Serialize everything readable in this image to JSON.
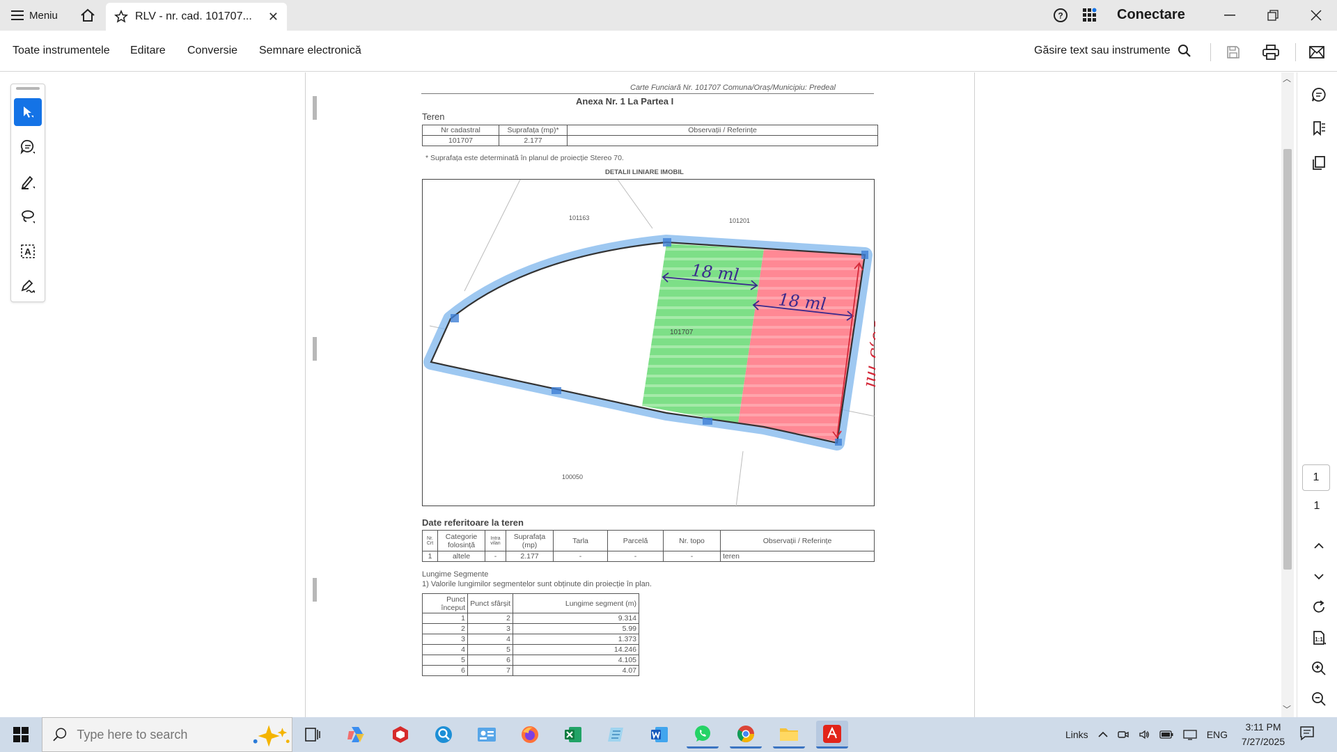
{
  "titlebar": {
    "menu_label": "Meniu",
    "tab_title": "RLV - nr. cad. 101707...",
    "signin_label": "Conectare"
  },
  "toolbar": {
    "items": [
      "Toate instrumentele",
      "Editare",
      "Conversie",
      "Semnare electronică"
    ],
    "find_label": "Găsire text sau instrumente"
  },
  "document": {
    "header_ref": "Carte Funciară Nr. 101707 Comuna/Oraș/Municipiu: Predeal",
    "title": "Anexa Nr. 1 La Partea I",
    "teren_label": "Teren",
    "teren_table": {
      "headers": [
        "Nr cadastral",
        "Suprafața (mp)*",
        "Observații / Referințe"
      ],
      "row": [
        "101707",
        "2.177",
        ""
      ]
    },
    "footnote": "* Suprafața este determinată în planul de proiecție Stereo 70.",
    "plan_title": "DETALII LINIARE IMOBIL",
    "plan_labels": {
      "parcel_nw": "101163",
      "parcel_ne": "101201",
      "parcel_main": "101707",
      "parcel_s": "100050",
      "width_a": "18 ml",
      "width_b": "18 ml",
      "length": "36,5 ml"
    },
    "date_title": "Date referitoare la teren",
    "date_table": {
      "headers": [
        "Nr. Crt",
        "Categorie folosință",
        "Intra vilan",
        "Suprafața (mp)",
        "Tarla",
        "Parcelă",
        "Nr. topo",
        "Observații / Referințe"
      ],
      "row": [
        "1",
        "altele",
        "-",
        "2.177",
        "-",
        "-",
        "-",
        "teren"
      ]
    },
    "segment_title": "Lungime Segmente",
    "segment_note": "1) Valorile lungimilor segmentelor sunt obținute din proiecție în plan.",
    "segment_table": {
      "headers": [
        "Punct început",
        "Punct sfârșit",
        "Lungime segment (m)"
      ],
      "rows": [
        [
          "1",
          "2",
          "9.314"
        ],
        [
          "2",
          "3",
          "5.99"
        ],
        [
          "3",
          "4",
          "1.373"
        ],
        [
          "4",
          "5",
          "14.246"
        ],
        [
          "5",
          "6",
          "4.105"
        ],
        [
          "6",
          "7",
          "4.07"
        ]
      ]
    }
  },
  "navigation": {
    "current_page": "1",
    "total_pages": "1"
  },
  "taskbar": {
    "search_placeholder": "Type here to search",
    "links_label": "Links",
    "language": "ENG",
    "time": "3:11 PM",
    "date": "7/27/2025"
  },
  "colors": {
    "accent": "#1473e6",
    "green_zone": "#5bd36a",
    "red_zone": "#ff6f7d",
    "blue_marker": "#6aa9ea",
    "purple_ink": "#3a2a8c",
    "red_ink": "#d42a3a"
  }
}
